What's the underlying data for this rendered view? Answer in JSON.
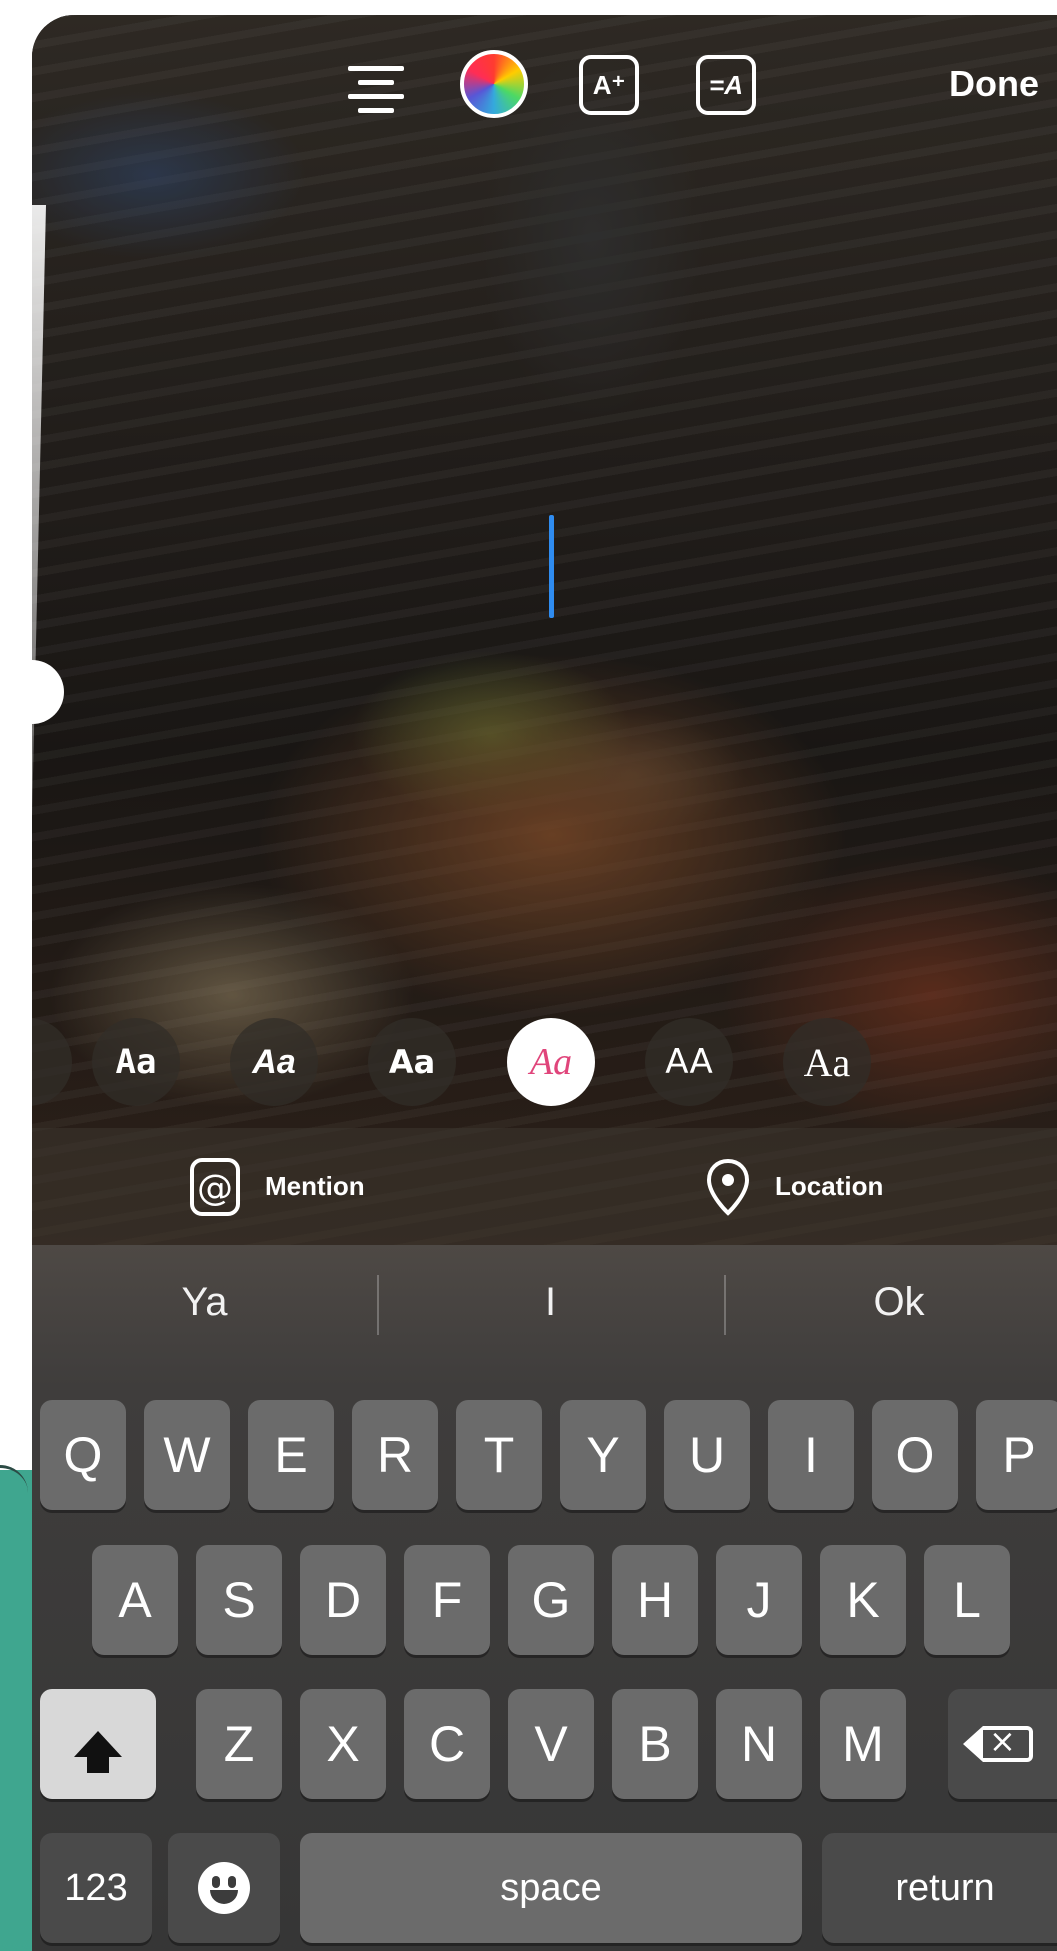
{
  "toolbar": {
    "align_icon": "text-align-center-icon",
    "color_icon": "color-wheel-icon",
    "effects_icon": "text-effects-icon",
    "effects_label": "A⁺",
    "animation_icon": "text-animation-icon",
    "animation_label": "=A",
    "done_label": "Done"
  },
  "fonts": {
    "items": [
      "Aa",
      "Aa",
      "Aa",
      "Aa",
      "AA",
      "Aa"
    ],
    "selected_index": 3
  },
  "tags": {
    "mention_label": "Mention",
    "location_label": "Location"
  },
  "suggestions": [
    "Ya",
    "I",
    "Ok"
  ],
  "keyboard": {
    "row1": [
      "Q",
      "W",
      "E",
      "R",
      "T",
      "Y",
      "U",
      "I",
      "O",
      "P"
    ],
    "row2": [
      "A",
      "S",
      "D",
      "F",
      "G",
      "H",
      "J",
      "K",
      "L"
    ],
    "row3": [
      "Z",
      "X",
      "C",
      "V",
      "B",
      "N",
      "M"
    ],
    "numbers_label": "123",
    "space_label": "space",
    "return_label": "return"
  },
  "colors": {
    "cursor": "#2f8cf0",
    "selected_font": "#e0457b",
    "teal_background": "#3fa68f"
  }
}
